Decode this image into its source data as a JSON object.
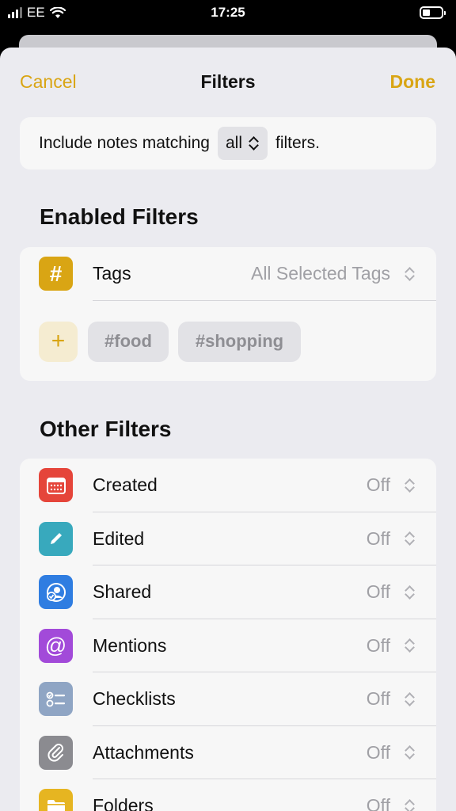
{
  "status": {
    "carrier": "EE",
    "time": "17:25"
  },
  "nav": {
    "cancel": "Cancel",
    "title": "Filters",
    "done": "Done"
  },
  "match": {
    "prefix": "Include notes matching",
    "selected": "all",
    "suffix": "filters."
  },
  "enabled": {
    "title": "Enabled Filters",
    "tags_label": "Tags",
    "tags_value": "All Selected Tags",
    "add_symbol": "+",
    "chips": [
      "#food",
      "#shopping"
    ]
  },
  "other": {
    "title": "Other Filters",
    "items": [
      {
        "label": "Created",
        "value": "Off",
        "icon": "calendar-icon",
        "color": "#e5453a"
      },
      {
        "label": "Edited",
        "value": "Off",
        "icon": "pencil-icon",
        "color": "#38a9bd"
      },
      {
        "label": "Shared",
        "value": "Off",
        "icon": "shared-person-icon",
        "color": "#2f7de1"
      },
      {
        "label": "Mentions",
        "value": "Off",
        "icon": "at-sign-icon",
        "color": "#a24ad9"
      },
      {
        "label": "Checklists",
        "value": "Off",
        "icon": "checklist-icon",
        "color": "#8fa5c4"
      },
      {
        "label": "Attachments",
        "value": "Off",
        "icon": "paperclip-icon",
        "color": "#8b8b90"
      },
      {
        "label": "Folders",
        "value": "Off",
        "icon": "folder-icon",
        "color": "#e6b521"
      }
    ]
  },
  "colors": {
    "accent": "#d9a514",
    "tags_icon": "#d9a514"
  }
}
